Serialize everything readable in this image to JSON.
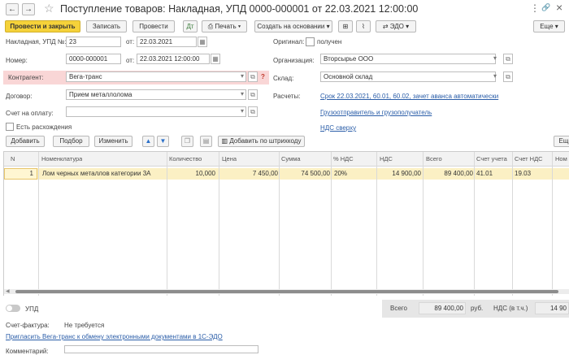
{
  "window": {
    "title": "Поступление товаров: Накладная, УПД 0000-000001 от 22.03.2021 12:00:00",
    "back_glyph": "←",
    "forward_glyph": "→",
    "star_glyph": "☆",
    "more_glyph": "⋮",
    "link_glyph": "🔗",
    "close_glyph": "×"
  },
  "toolbar": {
    "post_close": "Провести и закрыть",
    "save": "Записать",
    "post": "Провести",
    "print": "Печать",
    "create_based": "Создать на основании",
    "edo": "ЭДО",
    "more": "Еще"
  },
  "form": {
    "invoice_label": "Накладная, УПД №:",
    "invoice_no": "23",
    "from_label": "от:",
    "invoice_date": "22.03.2021",
    "original_label": "Оригинал:",
    "received_label": "получен",
    "number_label": "Номер:",
    "number_value": "0000-000001",
    "from_label2": "от:",
    "number_date": "22.03.2021 12:00:00",
    "org_label": "Организация:",
    "org_value": "Вторсырье ООО",
    "contractor_label": "Контрагент:",
    "contractor_value": "Вега-транс",
    "question_mark": "?",
    "warehouse_label": "Склад:",
    "warehouse_value": "Основной склад",
    "contract_label": "Договор:",
    "contract_value": "Прием металлолома",
    "settlements_label": "Расчеты:",
    "settlements_link": "Срок 22.03.2021, 60.01, 60.02, зачет аванса автоматически",
    "payment_label": "Счет на оплату:",
    "payment_value": "",
    "shipper_link": "Грузоотправитель и грузополучатель",
    "discrepancies_label": "Есть расхождения",
    "vat_link": "НДС сверху"
  },
  "table_toolbar": {
    "add": "Добавить",
    "select": "Подбор",
    "change": "Изменить",
    "barcode": "Добавить по штрихкоду",
    "more": "Ещ"
  },
  "table": {
    "headers": [
      "N",
      "Номенклатура",
      "Количество",
      "Цена",
      "Сумма",
      "% НДС",
      "НДС",
      "Всего",
      "Счет учета",
      "Счет НДС",
      "Ном"
    ],
    "rows": [
      [
        "1",
        "Лом черных металлов категории 3А",
        "10,000",
        "7 450,00",
        "74 500,00",
        "20%",
        "14 900,00",
        "89 400,00",
        "41.01",
        "19.03",
        ""
      ]
    ]
  },
  "totals": {
    "total_label": "Всего",
    "total_value": "89 400,00",
    "currency": "руб.",
    "vat_label": "НДС (в т.ч.)",
    "vat_value": "14 90"
  },
  "footer": {
    "upd_label": "УПД",
    "invoice_label": "Счет-фактура:",
    "invoice_value": "Не требуется",
    "invite_link": "Пригласить Вега-транс к обмену электронными документами в 1С-ЭДО",
    "comment_label": "Комментарий:"
  },
  "colors": {
    "accent": "#f5d23a",
    "selected_row": "#fbf0c4",
    "contractor_bg": "#f9d6d6",
    "link": "#2a5da8"
  }
}
